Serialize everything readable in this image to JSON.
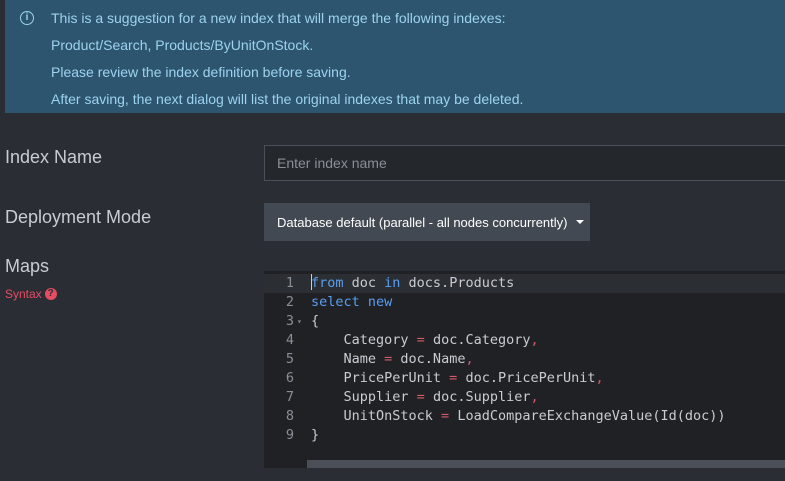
{
  "banner": {
    "icon": "info-circle-icon",
    "lines": [
      "This is a suggestion for a new index that will merge the following indexes:",
      "Product/Search, Products/ByUnitOnStock.",
      "Please review the index definition before saving.",
      "After saving, the next dialog will list the original indexes that may be deleted."
    ]
  },
  "form": {
    "index_name_label": "Index Name",
    "index_name_placeholder": "Enter index name",
    "index_name_value": "",
    "deployment_label": "Deployment Mode",
    "deployment_value": "Database default (parallel - all nodes concurrently)",
    "maps_label": "Maps",
    "syntax_label": "Syntax"
  },
  "editor": {
    "line_numbers": [
      "1",
      "2",
      "3",
      "4",
      "5",
      "6",
      "7",
      "8",
      "9"
    ],
    "lines": [
      "from doc in docs.Products",
      "select new",
      "{",
      "    Category = doc.Category,",
      "    Name = doc.Name,",
      "    PricePerUnit = doc.PricePerUnit,",
      "    Supplier = doc.Supplier,",
      "    UnitOnStock = LoadCompareExchangeValue(Id(doc))",
      "}"
    ]
  },
  "colors": {
    "banner_bg": "#2e5570",
    "banner_text": "#9cd3ee",
    "keyword": "#5a9ff0",
    "operator": "#d45a6a",
    "syntax_link": "#e44d62"
  }
}
